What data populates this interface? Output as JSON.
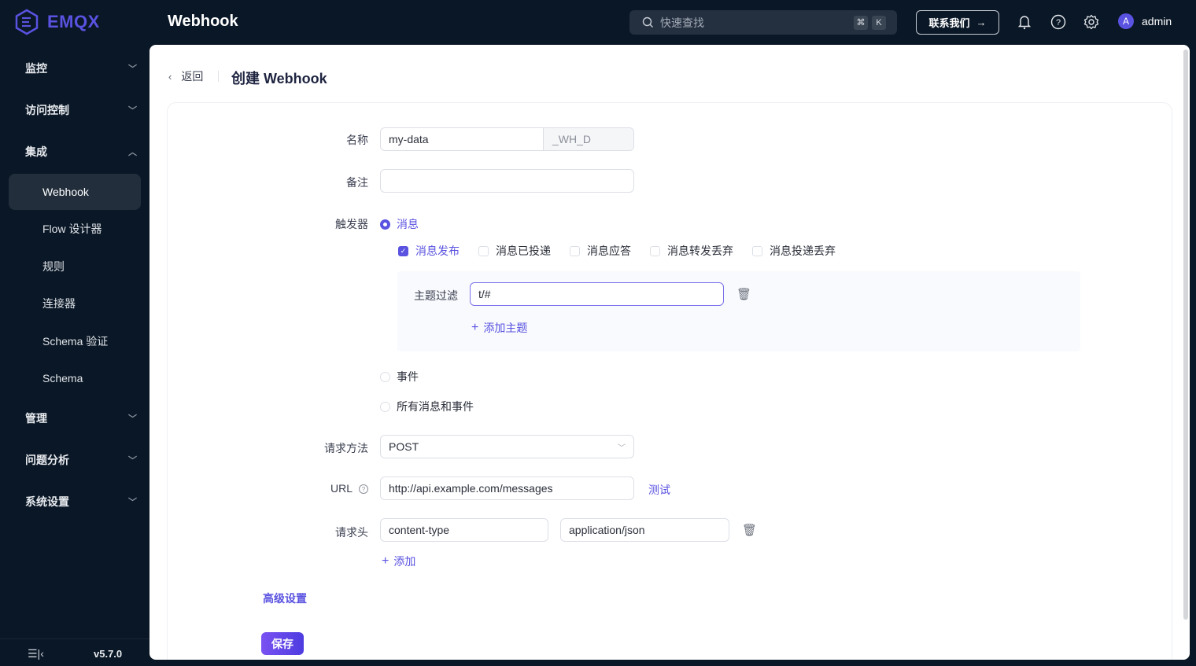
{
  "app": {
    "logo_text": "EMQX",
    "page_heading": "Webhook",
    "version": "v5.7.0"
  },
  "header": {
    "search_placeholder": "快速查找",
    "shortcut_keys": [
      "⌘",
      "K"
    ],
    "contact_label": "联系我们",
    "username": "admin",
    "avatar_letter": "A",
    "icons": [
      "bell-icon",
      "help-icon",
      "gear-icon"
    ]
  },
  "sidebar": {
    "groups": [
      {
        "label": "监控",
        "expanded": false
      },
      {
        "label": "访问控制",
        "expanded": false
      },
      {
        "label": "集成",
        "expanded": true
      },
      {
        "label": "管理",
        "expanded": false
      },
      {
        "label": "问题分析",
        "expanded": false
      },
      {
        "label": "系统设置",
        "expanded": false
      }
    ],
    "integration_items": [
      {
        "label": "Webhook",
        "active": true
      },
      {
        "label": "Flow 设计器",
        "active": false
      },
      {
        "label": "规则",
        "active": false
      },
      {
        "label": "连接器",
        "active": false
      },
      {
        "label": "Schema 验证",
        "active": false
      },
      {
        "label": "Schema",
        "active": false
      }
    ]
  },
  "page": {
    "back_label": "返回",
    "title": "创建 Webhook"
  },
  "form": {
    "name": {
      "label": "名称",
      "value": "my-data",
      "suffix": "_WH_D"
    },
    "note": {
      "label": "备注",
      "value": ""
    },
    "trigger": {
      "label": "触发器",
      "options": [
        {
          "label": "消息",
          "selected": true
        },
        {
          "label": "事件",
          "selected": false
        },
        {
          "label": "所有消息和事件",
          "selected": false
        }
      ],
      "message_events": [
        {
          "label": "消息发布",
          "checked": true
        },
        {
          "label": "消息已投递",
          "checked": false
        },
        {
          "label": "消息应答",
          "checked": false
        },
        {
          "label": "消息转发丢弃",
          "checked": false
        },
        {
          "label": "消息投递丢弃",
          "checked": false
        }
      ],
      "topic_filter": {
        "label": "主题过滤",
        "value": "t/#",
        "add_label": "添加主题"
      }
    },
    "method": {
      "label": "请求方法",
      "value": "POST"
    },
    "url": {
      "label": "URL",
      "value": "http://api.example.com/messages",
      "test_label": "测试"
    },
    "headers": {
      "label": "请求头",
      "rows": [
        {
          "key": "content-type",
          "value": "application/json"
        }
      ],
      "add_label": "添加"
    },
    "advanced_label": "高级设置",
    "save_label": "保存"
  },
  "colors": {
    "brand": "#5a52e0",
    "sidebar_bg": "#0a1726",
    "active_item_bg": "#222e3c"
  }
}
